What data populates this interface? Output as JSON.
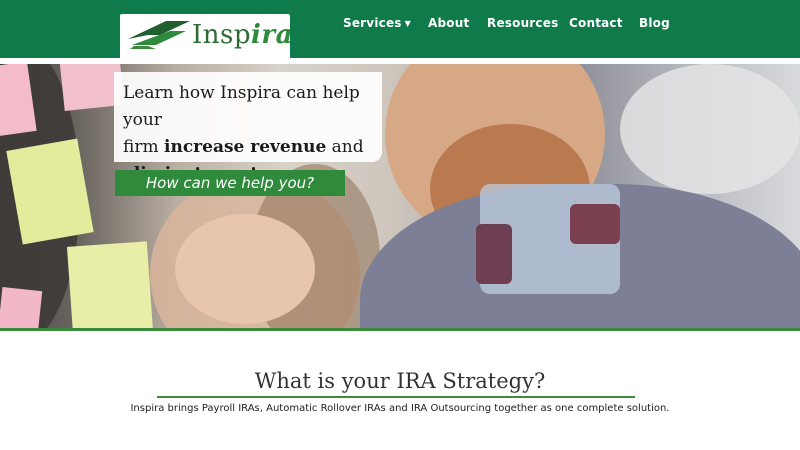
{
  "brand": {
    "name_main": "Insp",
    "name_accent": "ira",
    "colors": {
      "header": "#0f7a4a",
      "accent": "#2f8a3c",
      "logo_green": "#2e6a33"
    }
  },
  "nav": {
    "items": [
      {
        "label": "Services",
        "has_dropdown": true,
        "icon": "chevron-down-icon"
      },
      {
        "label": "About"
      },
      {
        "label": "Resources"
      },
      {
        "label": "Contact"
      },
      {
        "label": "Blog"
      }
    ]
  },
  "hero": {
    "line1": "Learn how Inspira can help your",
    "line2_prefix": "firm ",
    "line2_bold": "increase revenue",
    "line2_suffix": " and",
    "line3_bold": "eliminate costs",
    "line3_suffix": ".",
    "cta_label": "How can we help you?"
  },
  "main": {
    "title": "What is your IRA Strategy?",
    "tagline": "Inspira brings Payroll IRAs, Automatic Rollover IRAs and IRA Outsourcing together as one complete solution."
  }
}
